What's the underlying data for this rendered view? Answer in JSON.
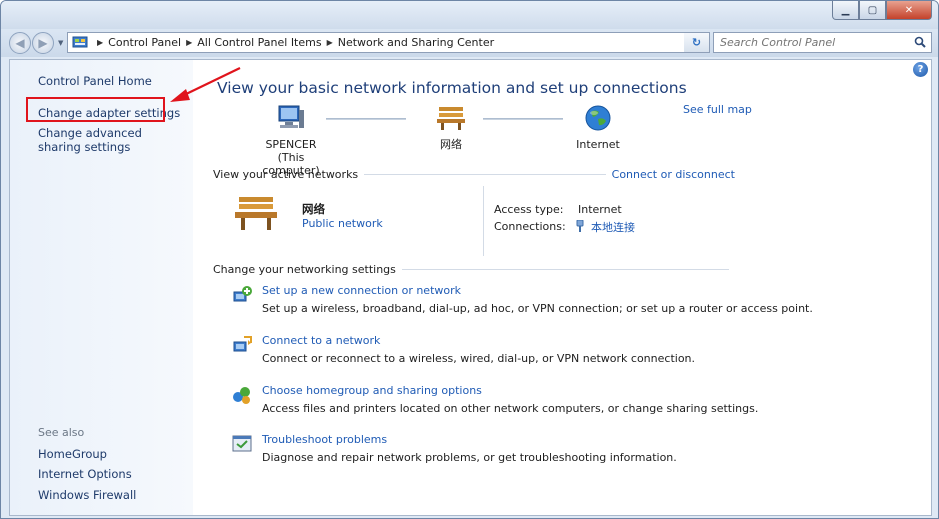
{
  "breadcrumb": [
    "Control Panel",
    "All Control Panel Items",
    "Network and Sharing Center"
  ],
  "search": {
    "placeholder": "Search Control Panel"
  },
  "sidebar": {
    "home": "Control Panel Home",
    "adapter": "Change adapter settings",
    "advanced": "Change advanced sharing settings",
    "see_also": "See also",
    "links": [
      "HomeGroup",
      "Internet Options",
      "Windows Firewall"
    ]
  },
  "main": {
    "title": "View your basic network information and set up connections",
    "see_full_map": "See full map",
    "map": {
      "computer": "SPENCER",
      "computer_sub": "(This computer)",
      "network": "网络",
      "internet": "Internet"
    },
    "active": {
      "heading": "View your active networks",
      "connect_link": "Connect or disconnect",
      "network_name": "网络",
      "network_type": "Public network",
      "access_label": "Access type:",
      "access_value": "Internet",
      "connections_label": "Connections:",
      "connections_value": "本地连接"
    },
    "change": {
      "heading": "Change your networking settings",
      "tasks": [
        {
          "link": "Set up a new connection or network",
          "desc": "Set up a wireless, broadband, dial-up, ad hoc, or VPN connection; or set up a router or access point."
        },
        {
          "link": "Connect to a network",
          "desc": "Connect or reconnect to a wireless, wired, dial-up, or VPN network connection."
        },
        {
          "link": "Choose homegroup and sharing options",
          "desc": "Access files and printers located on other network computers, or change sharing settings."
        },
        {
          "link": "Troubleshoot problems",
          "desc": "Diagnose and repair network problems, or get troubleshooting information."
        }
      ]
    }
  },
  "colors": {
    "link": "#1f5bb5",
    "title": "#1f3f79",
    "highlight": "#e0141c"
  }
}
